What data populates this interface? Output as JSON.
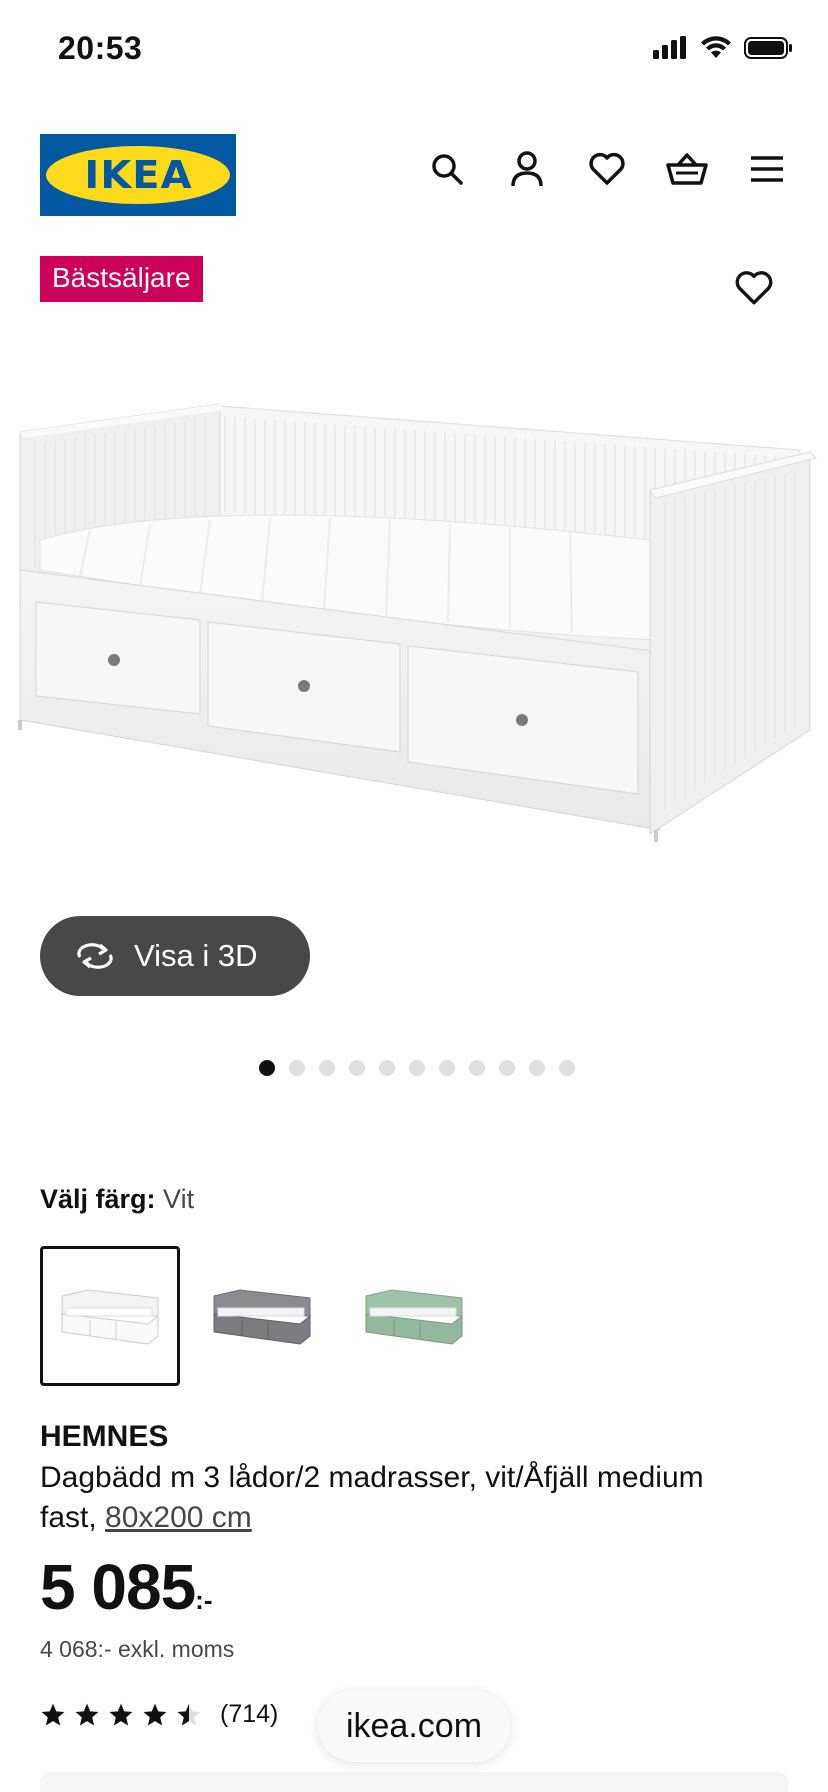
{
  "status": {
    "time": "20:53"
  },
  "header": {
    "logo_text": "IKEA"
  },
  "badge": {
    "label": "Bästsäljare"
  },
  "viewer": {
    "button_label": "Visa i 3D",
    "image_count": 11,
    "active_index": 0
  },
  "color": {
    "label": "Välj färg:",
    "value": "Vit",
    "options": [
      "white",
      "grey",
      "green"
    ],
    "selected": 0
  },
  "product": {
    "name": "HEMNES",
    "description": "Dagbädd m 3 lådor/2 madrasser, vit/Åfjäll medium fast,",
    "size_link": "80x200 cm",
    "price_main": "5 085",
    "price_suffix": ":-",
    "price_ex_vat": "4 068:- exkl. moms",
    "rating_value": 4.5,
    "rating_count": "(714)"
  },
  "browser": {
    "url": "ikea.com"
  },
  "colors": {
    "badge": "#cc0058",
    "ikea_blue": "#0058a3",
    "ikea_yellow": "#ffda1a",
    "button_dark": "#484848"
  }
}
